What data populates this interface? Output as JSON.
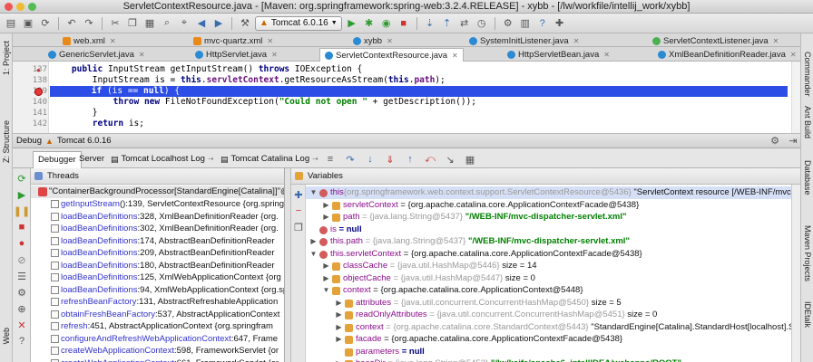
{
  "window": {
    "title": "ServletContextResource.java - [Maven: org.springframework:spring-web:3.2.4.RELEASE] - xybb - [/lw/workfile/intellij_work/xybb]"
  },
  "toolbar": {
    "run_config": "Tomcat 6.0.16"
  },
  "left_stripe": {
    "project": "1: Project",
    "structure": "Z: Structure",
    "web": "Web"
  },
  "right_stripe": {
    "commander": "Commander",
    "ant_build": "Ant Build",
    "database": "Database",
    "maven": "Maven Projects",
    "idetalk": "IDEtalk"
  },
  "tabs_row1": [
    {
      "label": "web.xml",
      "kind": "xml"
    },
    {
      "label": "mvc-quartz.xml",
      "kind": "xml"
    },
    {
      "label": "xybb",
      "kind": "module"
    },
    {
      "label": "SystemInitListener.java",
      "kind": "class"
    },
    {
      "label": "ServletContextListener.java",
      "kind": "interface"
    }
  ],
  "tabs_row2": [
    {
      "label": "GenericServlet.java",
      "kind": "class"
    },
    {
      "label": "HttpServlet.java",
      "kind": "class"
    },
    {
      "label": "ServletContextResource.java",
      "kind": "class",
      "active": true
    },
    {
      "label": "HttpServletBean.java",
      "kind": "class"
    },
    {
      "label": "XmlBeanDefinitionReader.java",
      "kind": "class"
    }
  ],
  "editor": {
    "line_numbers": [
      "137",
      "138",
      "139",
      "140",
      "141",
      "142"
    ],
    "current_line": "139"
  },
  "debug": {
    "title": "Debug",
    "config": "Tomcat 6.0.16",
    "tabs": [
      "Debugger",
      "Server",
      "Tomcat Localhost Log",
      "Tomcat Catalina Log"
    ],
    "threads_title": "Threads",
    "variables_title": "Variables",
    "thread": "\"ContainerBackgroundProcessor[StandardEngine[Catalina]]\"@",
    "frames": [
      {
        "method": "getInputStream",
        "rest": "():139, ServletContextResource {org.spring"
      },
      {
        "method": "loadBeanDefinitions",
        "rest": ":328, XmlBeanDefinitionReader {org."
      },
      {
        "method": "loadBeanDefinitions",
        "rest": ":302, XmlBeanDefinitionReader {org."
      },
      {
        "method": "loadBeanDefinitions",
        "rest": ":174, AbstractBeanDefinitionReader"
      },
      {
        "method": "loadBeanDefinitions",
        "rest": ":209, AbstractBeanDefinitionReader"
      },
      {
        "method": "loadBeanDefinitions",
        "rest": ":180, AbstractBeanDefinitionReader"
      },
      {
        "method": "loadBeanDefinitions",
        "rest": ":125, XmlWebApplicationContext {org"
      },
      {
        "method": "loadBeanDefinitions",
        "rest": ":94, XmlWebApplicationContext {org.sp"
      },
      {
        "method": "refreshBeanFactory",
        "rest": ":131, AbstractRefreshableApplication"
      },
      {
        "method": "obtainFreshBeanFactory",
        "rest": ":537, AbstractApplicationContext"
      },
      {
        "method": "refresh",
        "rest": ":451, AbstractApplicationContext {org.springfram"
      },
      {
        "method": "configureAndRefreshWebApplicationContext",
        "rest": ":647, Frame"
      },
      {
        "method": "createWebApplicationContext",
        "rest": ":598, FrameworkServlet {or"
      },
      {
        "method": "createWebApplicationContext",
        "rest": ":661, FrameworkServlet {or"
      }
    ],
    "variables": [
      {
        "indent": 0,
        "tri": "▼",
        "icon": "p",
        "name": "this",
        "type": "{org.springframework.web.context.support.ServletContextResource@5436}",
        "value": " \"ServletContext resource [/WEB-INF/mvc-dispatc",
        "sel": true
      },
      {
        "indent": 1,
        "tri": "▶",
        "icon": "f",
        "name": "servletContext",
        "type": "",
        "value": " = {org.apache.catalina.core.ApplicationContextFacade@5438}"
      },
      {
        "indent": 1,
        "tri": "▶",
        "icon": "f",
        "name": "path",
        "type": " = {java.lang.String@5437}",
        "value": " \"/WEB-INF/mvc-dispatcher-servlet.xml\"",
        "str": true
      },
      {
        "indent": 0,
        "tri": "",
        "icon": "p",
        "name": "is",
        "type": "",
        "value": " = null",
        "nullv": true
      },
      {
        "indent": 0,
        "tri": "▶",
        "icon": "p",
        "name": "this.path",
        "type": " = {java.lang.String@5437}",
        "value": " \"/WEB-INF/mvc-dispatcher-servlet.xml\"",
        "str": true
      },
      {
        "indent": 0,
        "tri": "▼",
        "icon": "p",
        "name": "this.servletContext",
        "type": "",
        "value": " = {org.apache.catalina.core.ApplicationContextFacade@5438}"
      },
      {
        "indent": 1,
        "tri": "▶",
        "icon": "f",
        "name": "classCache",
        "type": " = {java.util.HashMap@5446}",
        "value": " size = 14"
      },
      {
        "indent": 1,
        "tri": "▶",
        "icon": "f",
        "name": "objectCache",
        "type": " = {java.util.HashMap@5447}",
        "value": " size = 0"
      },
      {
        "indent": 1,
        "tri": "▼",
        "icon": "f",
        "name": "context",
        "type": "",
        "value": " = {org.apache.catalina.core.ApplicationContext@5448}"
      },
      {
        "indent": 2,
        "tri": "▶",
        "icon": "f",
        "name": "attributes",
        "type": " = {java.util.concurrent.ConcurrentHashMap@5450}",
        "value": " size = 5"
      },
      {
        "indent": 2,
        "tri": "▶",
        "icon": "f",
        "name": "readOnlyAttributes",
        "type": " = {java.util.concurrent.ConcurrentHashMap@5451}",
        "value": " size = 0"
      },
      {
        "indent": 2,
        "tri": "▶",
        "icon": "f",
        "name": "context",
        "type": " = {org.apache.catalina.core.StandardContext@5443}",
        "value": " \"StandardEngine[Catalina].StandardHost[localhost].StandardCo"
      },
      {
        "indent": 2,
        "tri": "▶",
        "icon": "f",
        "name": "facade",
        "type": "",
        "value": " = {org.apache.catalina.core.ApplicationContextFacade@5438}"
      },
      {
        "indent": 2,
        "tri": "",
        "icon": "f",
        "name": "parameters",
        "type": "",
        "value": " = null",
        "nullv": true
      },
      {
        "indent": 2,
        "tri": "▶",
        "icon": "f",
        "name": "baseDir",
        "type": " = {java.lang.String@5452}",
        "value": " \"/lw/kaifa/apache6_intellIDEA/webapps/ROOT\"",
        "str": true
      }
    ]
  }
}
